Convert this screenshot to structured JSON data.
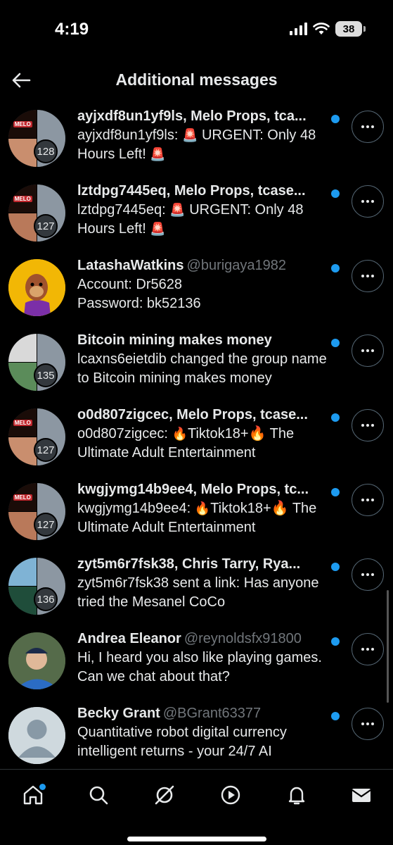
{
  "status_bar": {
    "time": "4:19",
    "battery": "38"
  },
  "header": {
    "title": "Additional messages"
  },
  "conversations": [
    {
      "type": "group",
      "name": "ayjxdf8un1yf9ls, Melo Props, tca...",
      "handle": "",
      "count": "128",
      "preview_prefix": "ayjxdf8un1yf9ls: ",
      "preview_icon": "🚨",
      "preview_text": " URGENT: Only 48 Hours Left! ",
      "preview_icon_end": "🚨",
      "unread": true
    },
    {
      "type": "group",
      "name": "lztdpg7445eq, Melo Props, tcase...",
      "handle": "",
      "count": "127",
      "preview_prefix": "lztdpg7445eq: ",
      "preview_icon": "🚨",
      "preview_text": " URGENT: Only 48 Hours Left! ",
      "preview_icon_end": "🚨",
      "unread": true
    },
    {
      "type": "single",
      "name": "LatashaWatkins",
      "handle": "@burigaya1982",
      "count": "",
      "preview_prefix": "Account: Dr5628",
      "preview_icon": "",
      "preview_text": "Password: bk52136",
      "preview_icon_end": "",
      "unread": true
    },
    {
      "type": "group",
      "name": "Bitcoin mining makes money",
      "handle": "",
      "count": "135",
      "preview_prefix": "lcaxns6eietdib changed the group name to Bitcoin mining makes money",
      "preview_icon": "",
      "preview_text": "",
      "preview_icon_end": "",
      "unread": true
    },
    {
      "type": "group",
      "name": "o0d807zigcec, Melo Props, tcase...",
      "handle": "",
      "count": "127",
      "preview_prefix": "o0d807zigcec: ",
      "preview_icon": "🔥",
      "preview_text": "Tiktok18+",
      "preview_icon_end": "🔥 The Ultimate Adult Entertainment",
      "unread": true
    },
    {
      "type": "group",
      "name": "kwgjymg14b9ee4, Melo Props, tc...",
      "handle": "",
      "count": "127",
      "preview_prefix": "kwgjymg14b9ee4: ",
      "preview_icon": "🔥",
      "preview_text": "Tiktok18+",
      "preview_icon_end": "🔥 The Ultimate Adult Entertainment",
      "unread": true
    },
    {
      "type": "group",
      "name": "zyt5m6r7fsk38, Chris Tarry, Rya...",
      "handle": "",
      "count": "136",
      "preview_prefix": "zyt5m6r7fsk38 sent a link: Has anyone tried the Mesanel CoCo",
      "preview_icon": "",
      "preview_text": "",
      "preview_icon_end": "",
      "unread": true
    },
    {
      "type": "single",
      "name": "Andrea Eleanor",
      "handle": "@reynoldsfx91800",
      "count": "",
      "preview_prefix": "Hi, I heard you also like playing games. Can we chat about that?",
      "preview_icon": "",
      "preview_text": "",
      "preview_icon_end": "",
      "unread": true
    },
    {
      "type": "single",
      "name": "Becky Grant",
      "handle": "@BGrant63377",
      "count": "",
      "preview_prefix": "Quantitative robot digital currency intelligent returns - your 24/7 AI",
      "preview_icon": "",
      "preview_text": "",
      "preview_icon_end": "",
      "unread": true
    }
  ],
  "nav": {
    "items": [
      "home-icon",
      "search-icon",
      "grok-icon",
      "video-icon",
      "notifications-icon",
      "messages-icon"
    ]
  },
  "colors": {
    "accent": "#1d9bf0",
    "background": "#000000",
    "secondary_text": "#71767b"
  }
}
